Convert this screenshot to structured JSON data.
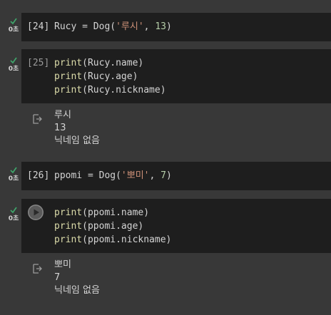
{
  "cells": [
    {
      "status_time": "0초",
      "exec_count": "[24]",
      "code": {
        "line1": {
          "pre": "Rucy = Dog(",
          "str": "'루시'",
          "mid": ", ",
          "num": "13",
          "post": ")"
        }
      }
    },
    {
      "status_time": "0초",
      "exec_count": "[25]",
      "code": {
        "lines": [
          {
            "fn": "print",
            "arg": "(Rucy.name)"
          },
          {
            "fn": "print",
            "arg": "(Rucy.age)"
          },
          {
            "fn": "print",
            "arg": "(Rucy.nickname)"
          }
        ]
      },
      "output": [
        "루시",
        "13",
        "닉네임 없음"
      ]
    },
    {
      "status_time": "0초",
      "exec_count": "[26]",
      "code": {
        "line1": {
          "pre": "ppomi = Dog(",
          "str": "'뽀미'",
          "mid": ", ",
          "num": "7",
          "post": ")"
        }
      }
    },
    {
      "status_time": "0초",
      "exec_count": "",
      "code": {
        "lines": [
          {
            "fn": "print",
            "arg": "(ppomi.name)"
          },
          {
            "fn": "print",
            "arg": "(ppomi.age)"
          },
          {
            "fn": "print",
            "arg": "(ppomi.nickname)"
          }
        ]
      },
      "output": [
        "뽀미",
        "7",
        "닉네임 없음"
      ]
    }
  ],
  "colors": {
    "background": "#383838",
    "code_bg": "#1e1e1e",
    "check": "#3fa46a",
    "string": "#ce9178",
    "number": "#b5cea8",
    "function": "#dcdcaa"
  }
}
